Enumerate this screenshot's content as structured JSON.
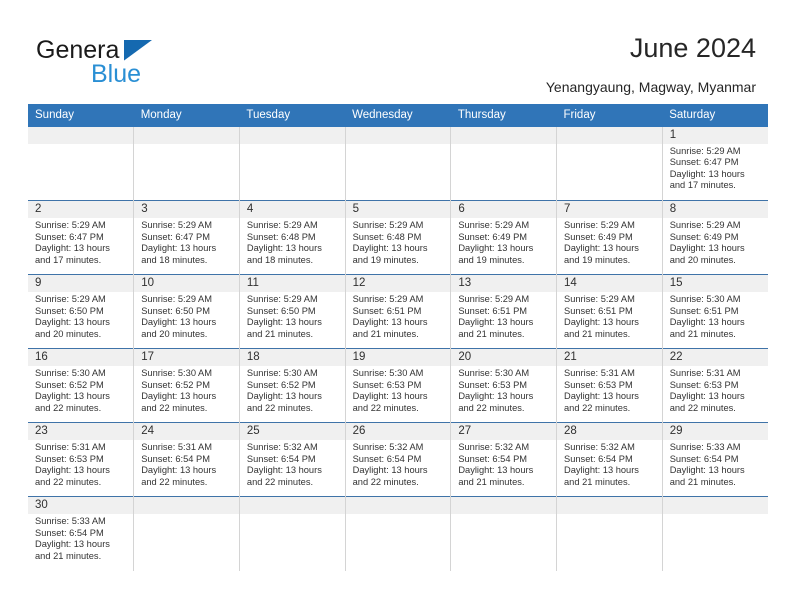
{
  "brand": {
    "name_top": "General",
    "name_bottom": "Blue",
    "triangle_icon": "triangle-icon",
    "color_dark": "#1a1a1a",
    "color_blue": "#2a8fd4",
    "color_triangle": "#1569b0"
  },
  "header": {
    "title": "June 2024",
    "subtitle": "Yenangyaung, Magway, Myanmar"
  },
  "theme": {
    "header_blue": "#3075b8",
    "row_divider": "#3f73a8",
    "daynum_strip": "#f0f0f0",
    "cell_divider": "#d4d4d4"
  },
  "labels": {
    "sunrise_prefix": "Sunrise:",
    "sunset_prefix": "Sunset:",
    "daylight_prefix": "Daylight:"
  },
  "weekday_headers": [
    "Sunday",
    "Monday",
    "Tuesday",
    "Wednesday",
    "Thursday",
    "Friday",
    "Saturday"
  ],
  "weeks": [
    [
      {
        "day": "",
        "lines": []
      },
      {
        "day": "",
        "lines": []
      },
      {
        "day": "",
        "lines": []
      },
      {
        "day": "",
        "lines": []
      },
      {
        "day": "",
        "lines": []
      },
      {
        "day": "",
        "lines": []
      },
      {
        "day": "1",
        "lines": [
          "Sunrise: 5:29 AM",
          "Sunset: 6:47 PM",
          "Daylight: 13 hours",
          "and 17 minutes."
        ]
      }
    ],
    [
      {
        "day": "2",
        "lines": [
          "Sunrise: 5:29 AM",
          "Sunset: 6:47 PM",
          "Daylight: 13 hours",
          "and 17 minutes."
        ]
      },
      {
        "day": "3",
        "lines": [
          "Sunrise: 5:29 AM",
          "Sunset: 6:47 PM",
          "Daylight: 13 hours",
          "and 18 minutes."
        ]
      },
      {
        "day": "4",
        "lines": [
          "Sunrise: 5:29 AM",
          "Sunset: 6:48 PM",
          "Daylight: 13 hours",
          "and 18 minutes."
        ]
      },
      {
        "day": "5",
        "lines": [
          "Sunrise: 5:29 AM",
          "Sunset: 6:48 PM",
          "Daylight: 13 hours",
          "and 19 minutes."
        ]
      },
      {
        "day": "6",
        "lines": [
          "Sunrise: 5:29 AM",
          "Sunset: 6:49 PM",
          "Daylight: 13 hours",
          "and 19 minutes."
        ]
      },
      {
        "day": "7",
        "lines": [
          "Sunrise: 5:29 AM",
          "Sunset: 6:49 PM",
          "Daylight: 13 hours",
          "and 19 minutes."
        ]
      },
      {
        "day": "8",
        "lines": [
          "Sunrise: 5:29 AM",
          "Sunset: 6:49 PM",
          "Daylight: 13 hours",
          "and 20 minutes."
        ]
      }
    ],
    [
      {
        "day": "9",
        "lines": [
          "Sunrise: 5:29 AM",
          "Sunset: 6:50 PM",
          "Daylight: 13 hours",
          "and 20 minutes."
        ]
      },
      {
        "day": "10",
        "lines": [
          "Sunrise: 5:29 AM",
          "Sunset: 6:50 PM",
          "Daylight: 13 hours",
          "and 20 minutes."
        ]
      },
      {
        "day": "11",
        "lines": [
          "Sunrise: 5:29 AM",
          "Sunset: 6:50 PM",
          "Daylight: 13 hours",
          "and 21 minutes."
        ]
      },
      {
        "day": "12",
        "lines": [
          "Sunrise: 5:29 AM",
          "Sunset: 6:51 PM",
          "Daylight: 13 hours",
          "and 21 minutes."
        ]
      },
      {
        "day": "13",
        "lines": [
          "Sunrise: 5:29 AM",
          "Sunset: 6:51 PM",
          "Daylight: 13 hours",
          "and 21 minutes."
        ]
      },
      {
        "day": "14",
        "lines": [
          "Sunrise: 5:29 AM",
          "Sunset: 6:51 PM",
          "Daylight: 13 hours",
          "and 21 minutes."
        ]
      },
      {
        "day": "15",
        "lines": [
          "Sunrise: 5:30 AM",
          "Sunset: 6:51 PM",
          "Daylight: 13 hours",
          "and 21 minutes."
        ]
      }
    ],
    [
      {
        "day": "16",
        "lines": [
          "Sunrise: 5:30 AM",
          "Sunset: 6:52 PM",
          "Daylight: 13 hours",
          "and 22 minutes."
        ]
      },
      {
        "day": "17",
        "lines": [
          "Sunrise: 5:30 AM",
          "Sunset: 6:52 PM",
          "Daylight: 13 hours",
          "and 22 minutes."
        ]
      },
      {
        "day": "18",
        "lines": [
          "Sunrise: 5:30 AM",
          "Sunset: 6:52 PM",
          "Daylight: 13 hours",
          "and 22 minutes."
        ]
      },
      {
        "day": "19",
        "lines": [
          "Sunrise: 5:30 AM",
          "Sunset: 6:53 PM",
          "Daylight: 13 hours",
          "and 22 minutes."
        ]
      },
      {
        "day": "20",
        "lines": [
          "Sunrise: 5:30 AM",
          "Sunset: 6:53 PM",
          "Daylight: 13 hours",
          "and 22 minutes."
        ]
      },
      {
        "day": "21",
        "lines": [
          "Sunrise: 5:31 AM",
          "Sunset: 6:53 PM",
          "Daylight: 13 hours",
          "and 22 minutes."
        ]
      },
      {
        "day": "22",
        "lines": [
          "Sunrise: 5:31 AM",
          "Sunset: 6:53 PM",
          "Daylight: 13 hours",
          "and 22 minutes."
        ]
      }
    ],
    [
      {
        "day": "23",
        "lines": [
          "Sunrise: 5:31 AM",
          "Sunset: 6:53 PM",
          "Daylight: 13 hours",
          "and 22 minutes."
        ]
      },
      {
        "day": "24",
        "lines": [
          "Sunrise: 5:31 AM",
          "Sunset: 6:54 PM",
          "Daylight: 13 hours",
          "and 22 minutes."
        ]
      },
      {
        "day": "25",
        "lines": [
          "Sunrise: 5:32 AM",
          "Sunset: 6:54 PM",
          "Daylight: 13 hours",
          "and 22 minutes."
        ]
      },
      {
        "day": "26",
        "lines": [
          "Sunrise: 5:32 AM",
          "Sunset: 6:54 PM",
          "Daylight: 13 hours",
          "and 22 minutes."
        ]
      },
      {
        "day": "27",
        "lines": [
          "Sunrise: 5:32 AM",
          "Sunset: 6:54 PM",
          "Daylight: 13 hours",
          "and 21 minutes."
        ]
      },
      {
        "day": "28",
        "lines": [
          "Sunrise: 5:32 AM",
          "Sunset: 6:54 PM",
          "Daylight: 13 hours",
          "and 21 minutes."
        ]
      },
      {
        "day": "29",
        "lines": [
          "Sunrise: 5:33 AM",
          "Sunset: 6:54 PM",
          "Daylight: 13 hours",
          "and 21 minutes."
        ]
      }
    ],
    [
      {
        "day": "30",
        "lines": [
          "Sunrise: 5:33 AM",
          "Sunset: 6:54 PM",
          "Daylight: 13 hours",
          "and 21 minutes."
        ]
      },
      {
        "day": "",
        "lines": []
      },
      {
        "day": "",
        "lines": []
      },
      {
        "day": "",
        "lines": []
      },
      {
        "day": "",
        "lines": []
      },
      {
        "day": "",
        "lines": []
      },
      {
        "day": "",
        "lines": []
      }
    ]
  ]
}
